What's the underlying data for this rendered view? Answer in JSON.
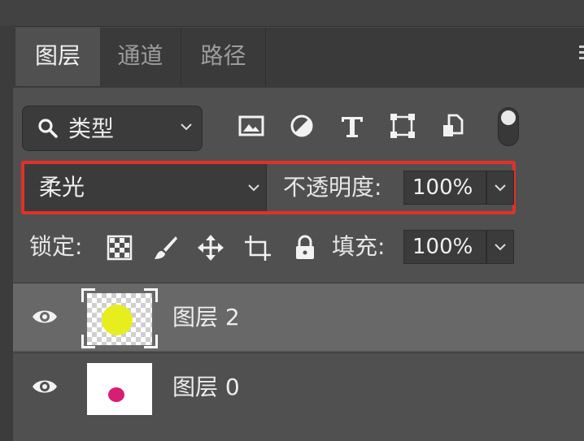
{
  "tabs": [
    {
      "label": "图层",
      "active": true
    },
    {
      "label": "通道",
      "active": false
    },
    {
      "label": "路径",
      "active": false
    }
  ],
  "filter": {
    "kind_label": "类型",
    "icons": [
      "image-filter-icon",
      "adjustment-filter-icon",
      "type-filter-icon",
      "shape-filter-icon",
      "smart-object-filter-icon"
    ]
  },
  "blend": {
    "mode": "柔光",
    "opacity_label": "不透明度:",
    "opacity_value": "100%"
  },
  "lock": {
    "label": "锁定:",
    "icons": [
      "lock-transparent-pixels-icon",
      "lock-image-pixels-icon",
      "lock-position-icon",
      "lock-artboard-icon",
      "lock-all-icon"
    ],
    "fill_label": "填充:",
    "fill_value": "100%"
  },
  "layers": [
    {
      "name": "图层 2",
      "selected": true,
      "thumbnail": "yellow-circle-on-transparent"
    },
    {
      "name": "图层 0",
      "selected": false,
      "thumbnail": "pink-dot-on-white"
    }
  ],
  "colors": {
    "highlight_border": "#e13127",
    "panel_bg": "#505050",
    "selected_row": "#686868",
    "yellow": "#e8ee1e",
    "pink": "#d81e72"
  }
}
